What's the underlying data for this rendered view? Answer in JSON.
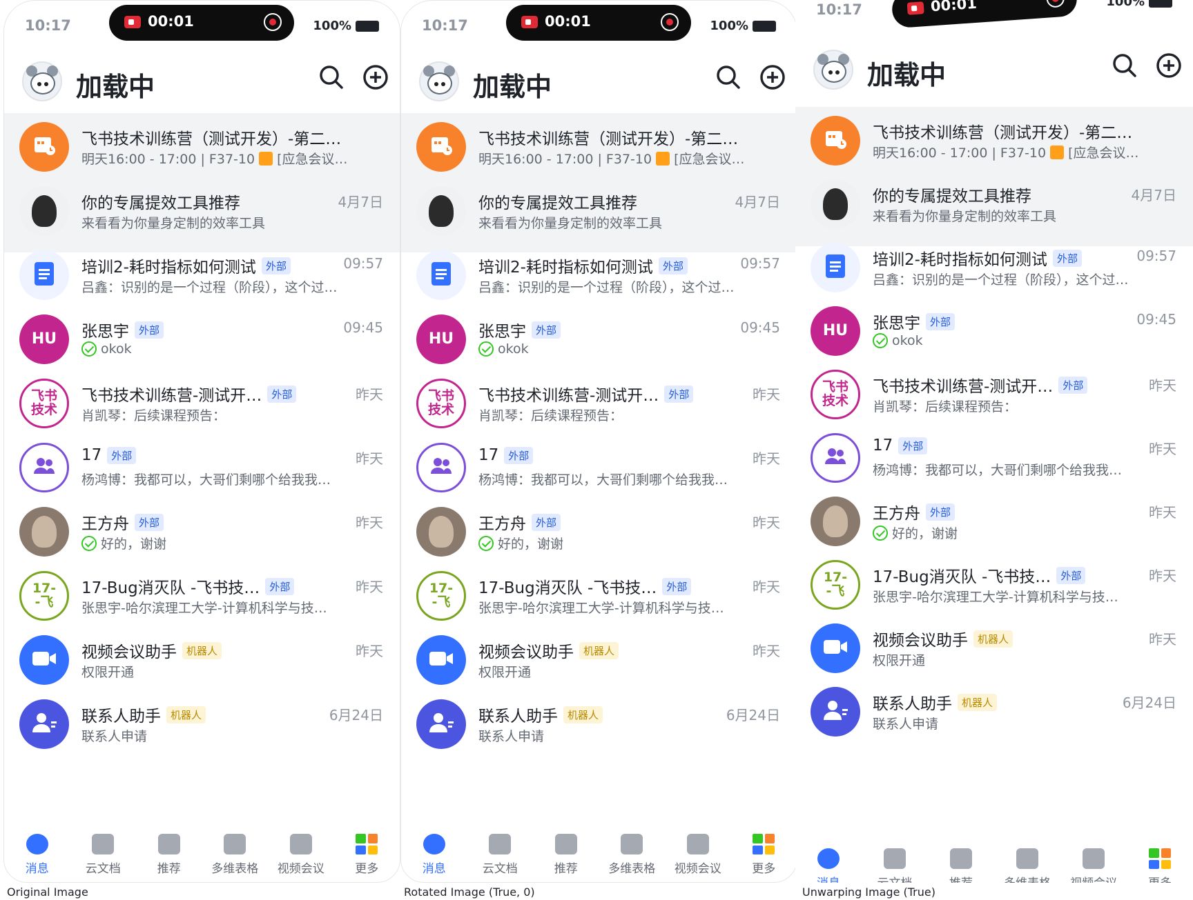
{
  "status_bar": {
    "time": "10:17",
    "battery": "100%",
    "record_time": "00:01"
  },
  "header": {
    "title": "加载中"
  },
  "chats": [
    {
      "name": "飞书技术训练营（测试开发）-第二…",
      "preview": "明天16:00 - 17:00 | F37-10",
      "preview_tail": "[应急会议…",
      "time": "",
      "tag": "",
      "avatar_text": "",
      "avatar_color": "#f8812b",
      "icon": "calendar-icon",
      "status_check": false,
      "room_icon": true
    },
    {
      "name": "你的专属提效工具推荐",
      "preview": "来看看为你量身定制的效率工具",
      "time": "4月7日",
      "tag": "",
      "avatar_text": "",
      "avatar_color": "#f0f1f3",
      "icon": "person-photo-avatar",
      "status_check": false
    },
    {
      "name": "培训2-耗时指标如何测试",
      "preview": "吕鑫：识别的是一个过程（阶段），这个过…",
      "time": "09:57",
      "tag": "外部",
      "avatar_text": "",
      "avatar_color": "#eef3ff",
      "icon": "document-icon",
      "status_check": false
    },
    {
      "name": "张思宇",
      "preview": "okok",
      "time": "09:45",
      "tag": "外部",
      "avatar_text": "HU",
      "avatar_color": "#c2258d",
      "icon": "",
      "status_check": true
    },
    {
      "name": "飞书技术训练营-测试开…",
      "preview": "肖凯琴：后续课程预告：",
      "time": "昨天",
      "tag": "外部",
      "avatar_text": "飞书\n技术",
      "avatar_color": "#ffffff",
      "icon": "group-text-avatar",
      "status_check": false
    },
    {
      "name": "17",
      "preview": "杨鸿博：我都可以，大哥们剩哪个给我我…",
      "time": "昨天",
      "tag": "外部",
      "avatar_text": "",
      "avatar_color": "#ffffff",
      "icon": "group-icon",
      "status_check": false
    },
    {
      "name": "王方舟",
      "preview": "好的，谢谢",
      "time": "昨天",
      "tag": "外部",
      "avatar_text": "",
      "avatar_color": "#8a7a6e",
      "icon": "person-photo-avatar",
      "status_check": true
    },
    {
      "name": "17-Bug消灭队 -飞书技…",
      "preview": "张思宇-哈尔滨理工大学-计算机科学与技…",
      "time": "昨天",
      "tag": "外部",
      "avatar_text": "17-\n-飞",
      "avatar_color": "#ffffff",
      "icon": "group-text-avatar",
      "status_check": false
    },
    {
      "name": "视频会议助手",
      "preview": "权限开通",
      "time": "昨天",
      "tag": "机器人",
      "avatar_text": "",
      "avatar_color": "#3370ff",
      "icon": "video-camera-icon",
      "status_check": false
    },
    {
      "name": "联系人助手",
      "preview": "联系人申请",
      "time": "6月24日",
      "tag": "机器人",
      "avatar_text": "",
      "avatar_color": "#4c55e0",
      "icon": "contact-icon",
      "status_check": false
    }
  ],
  "tabs": [
    {
      "label": "消息",
      "active": true
    },
    {
      "label": "云文档",
      "active": false
    },
    {
      "label": "推荐",
      "active": false
    },
    {
      "label": "多维表格",
      "active": false
    },
    {
      "label": "视频会议",
      "active": false
    },
    {
      "label": "更多",
      "active": false
    }
  ],
  "captions": {
    "original": "Original Image",
    "rotated": "Rotated Image (True, 0)",
    "unwarped": "Unwarping Image (True)"
  },
  "colors": {
    "accent": "#3370ff",
    "external_tag_bg": "#e1eaff",
    "bot_tag_bg": "#fdf4d6",
    "record_red": "#e02b37"
  }
}
